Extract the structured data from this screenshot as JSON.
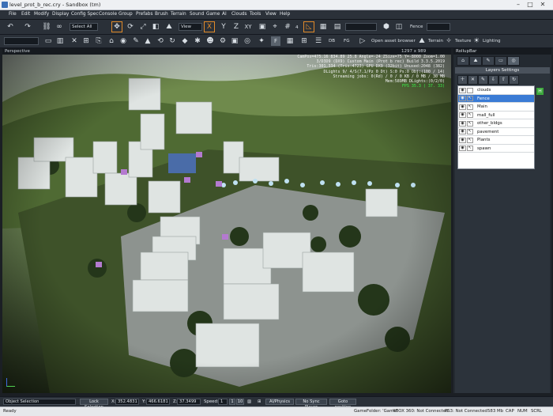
{
  "window": {
    "title": "level_prot_b_rec.cry - Sandbox (tm)",
    "min": "–",
    "max": "□",
    "close": "✕"
  },
  "menu": [
    "File",
    "Edit",
    "Modify",
    "Display",
    "Config Spec",
    "Console",
    "Group",
    "Prefabs",
    "Brush",
    "Terrain",
    "Sound",
    "Game",
    "AI",
    "Clouds",
    "Tools",
    "View",
    "Help"
  ],
  "toolbar": {
    "select_all": "Select All",
    "view_box": "View",
    "axis_x": "X",
    "axis_y": "Y",
    "axis_z": "Z",
    "axis_xy": "XY",
    "snap_value": "4",
    "fence_label": "Fence",
    "browser_label": "Open asset browser",
    "terrain_label": "Terrain",
    "texture_label": "Texture",
    "lighting_label": "Lighting",
    "db_label": "DB",
    "fg_label": "FG",
    "f_label": "F"
  },
  "viewport": {
    "title": "Perspective",
    "resolution": "1297 x 989",
    "hud": [
      "CamPos=475.16 834.89 25.8 Angle=-24  ZSize=75 Y=-8000 Zoom=1.00",
      "3/D3D9 (DX9) Custom Main (Prot b rec) Build 3.3.5.2019",
      "Tris:301,334 (Tris:4723) GPU DX9 (32bit) Unused:2048 (382)",
      "DLights 9/ 4/S(7.1/Pz 0 Dt) S:0 Ps:0 Obj:(100 / 14)",
      "Streaming jobs: 0(Rd) / 0 / 0 KB / 0 MB / 30 MB",
      "Mem:589MB DLights:(0/2/0)"
    ],
    "fps": "FPS 35.3 ( 37. 33)"
  },
  "rollup": {
    "title": "RollupBar",
    "layers_title": "Layers Settings",
    "layers": [
      {
        "name": "clouds",
        "selected": false
      },
      {
        "name": "Fence",
        "selected": true
      },
      {
        "name": "Main",
        "selected": false
      },
      {
        "name": "mall_full",
        "selected": false
      },
      {
        "name": "other_bldgs",
        "selected": false
      },
      {
        "name": "pavement",
        "selected": false
      },
      {
        "name": "Plants",
        "selected": false
      },
      {
        "name": "spawn",
        "selected": false
      }
    ],
    "hide_icon": "H"
  },
  "bottom": {
    "mode": "Object Selection",
    "lock": "Lock Selection",
    "x_label": "X:",
    "x_val": "352.4831",
    "y_label": "Y:",
    "y_val": "466.6181",
    "z_label": "Z:",
    "z_val": "37.3499",
    "speed_label": "Speed:",
    "speed_1": "1",
    "speed_2": "1",
    "speed_3": "10",
    "ai_physics": "AI/Physics",
    "no_sync": "No Sync Player",
    "goto": "Goto position"
  },
  "status": {
    "ready": "Ready",
    "game_folder": "GameFolder: 'Game'",
    "xbox": "XBOX 360: Not Connected",
    "ps3": "PS3: Not Connected",
    "mem": "583 Mb",
    "cap": "CAP",
    "num": "NUM",
    "scrl": "SCRL"
  }
}
